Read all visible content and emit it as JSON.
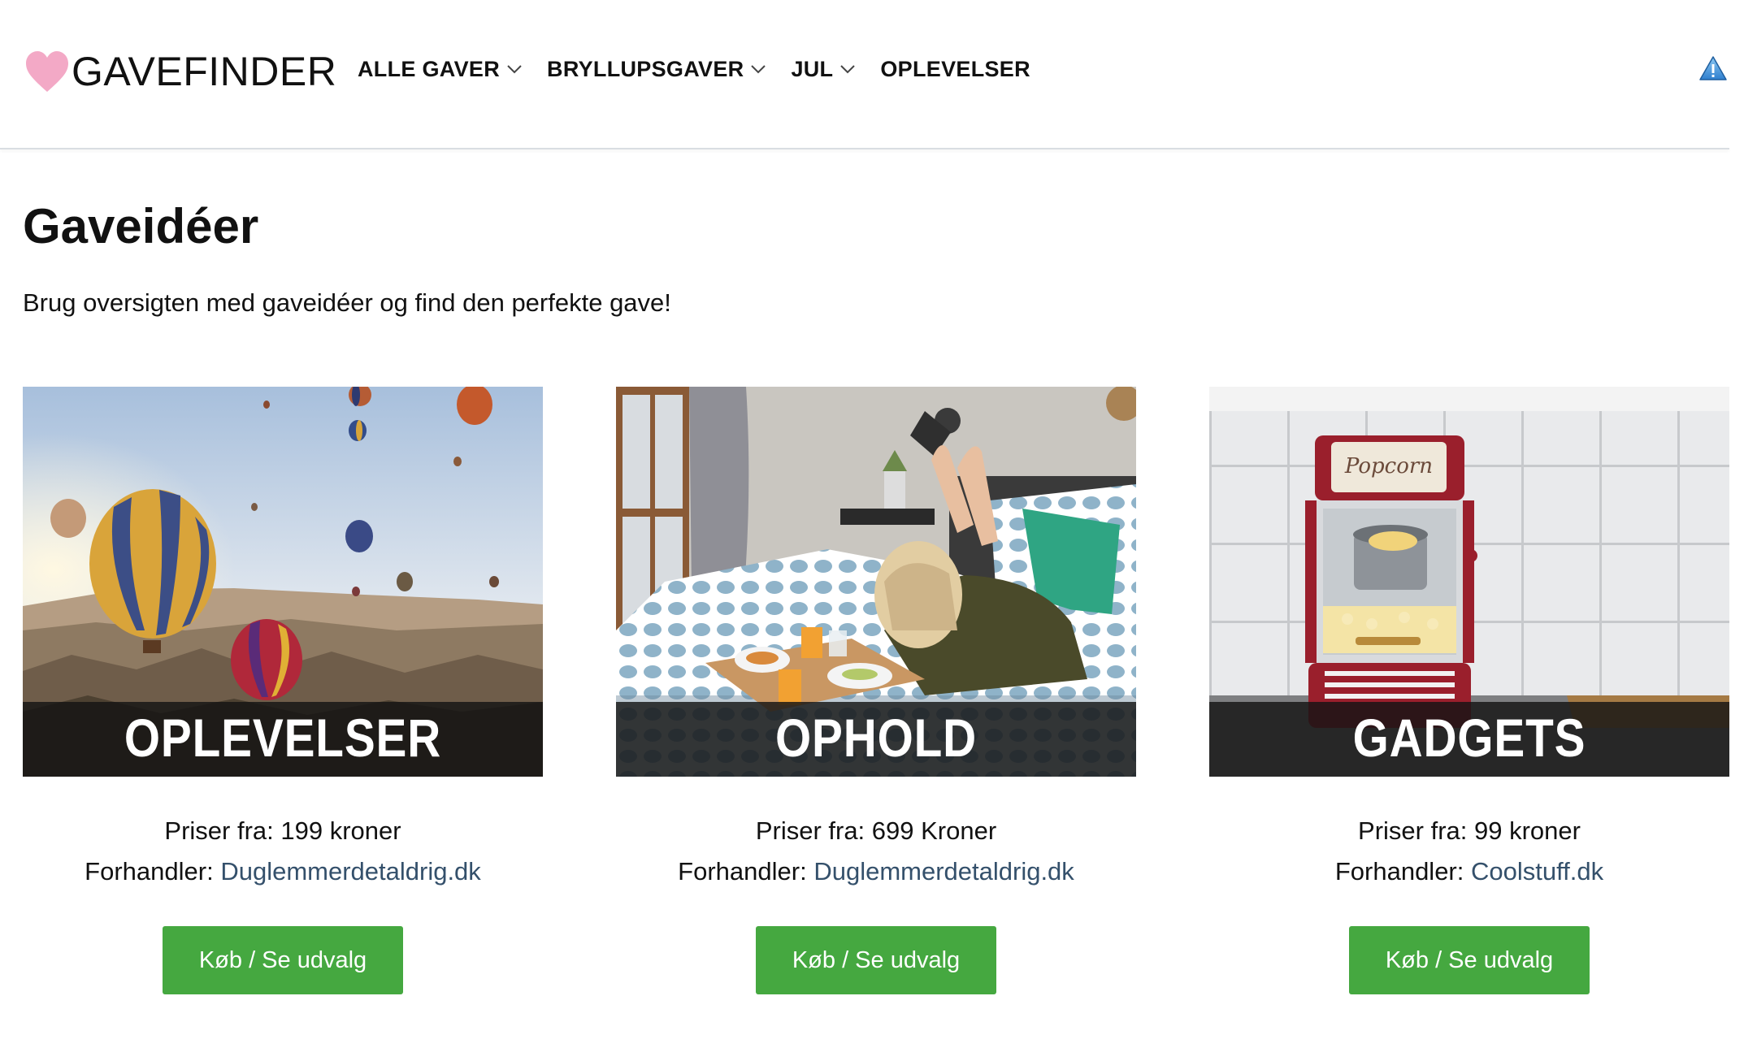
{
  "header": {
    "logo_text": "GAVEFINDER",
    "nav": [
      {
        "label": "ALLE GAVER",
        "has_dropdown": true
      },
      {
        "label": "BRYLLUPSGAVER",
        "has_dropdown": true
      },
      {
        "label": "JUL",
        "has_dropdown": true
      },
      {
        "label": "OPLEVELSER",
        "has_dropdown": false
      }
    ],
    "warning_icon": "warning-triangle-icon"
  },
  "page": {
    "title": "Gaveidéer",
    "intro": "Brug oversigten med gaveidéer og find den perfekte gave!"
  },
  "cards": [
    {
      "overlay": "OPLEVELSER",
      "image": "hot-air-balloons-photo",
      "price": "Priser fra: 199 kroner",
      "dealer_label": "Forhandler:",
      "dealer_link": "Duglemmerdetaldrig.dk",
      "button": "Køb / Se udvalg"
    },
    {
      "overlay": "OPHOLD",
      "image": "breakfast-in-bed-photo",
      "price": "Priser fra: 699 Kroner",
      "dealer_label": "Forhandler:",
      "dealer_link": "Duglemmerdetaldrig.dk",
      "button": "Køb / Se udvalg"
    },
    {
      "overlay": "GADGETS",
      "image": "popcorn-machine-photo",
      "price": "Priser fra: 99 kroner",
      "dealer_label": "Forhandler:",
      "dealer_link": "Coolstuff.dk",
      "button": "Køb / Se udvalg"
    }
  ],
  "colors": {
    "accent_green": "#45a840",
    "link": "#34506b",
    "heart_pink": "#f3a9c6",
    "warning_blue": "#3b8fd6"
  }
}
